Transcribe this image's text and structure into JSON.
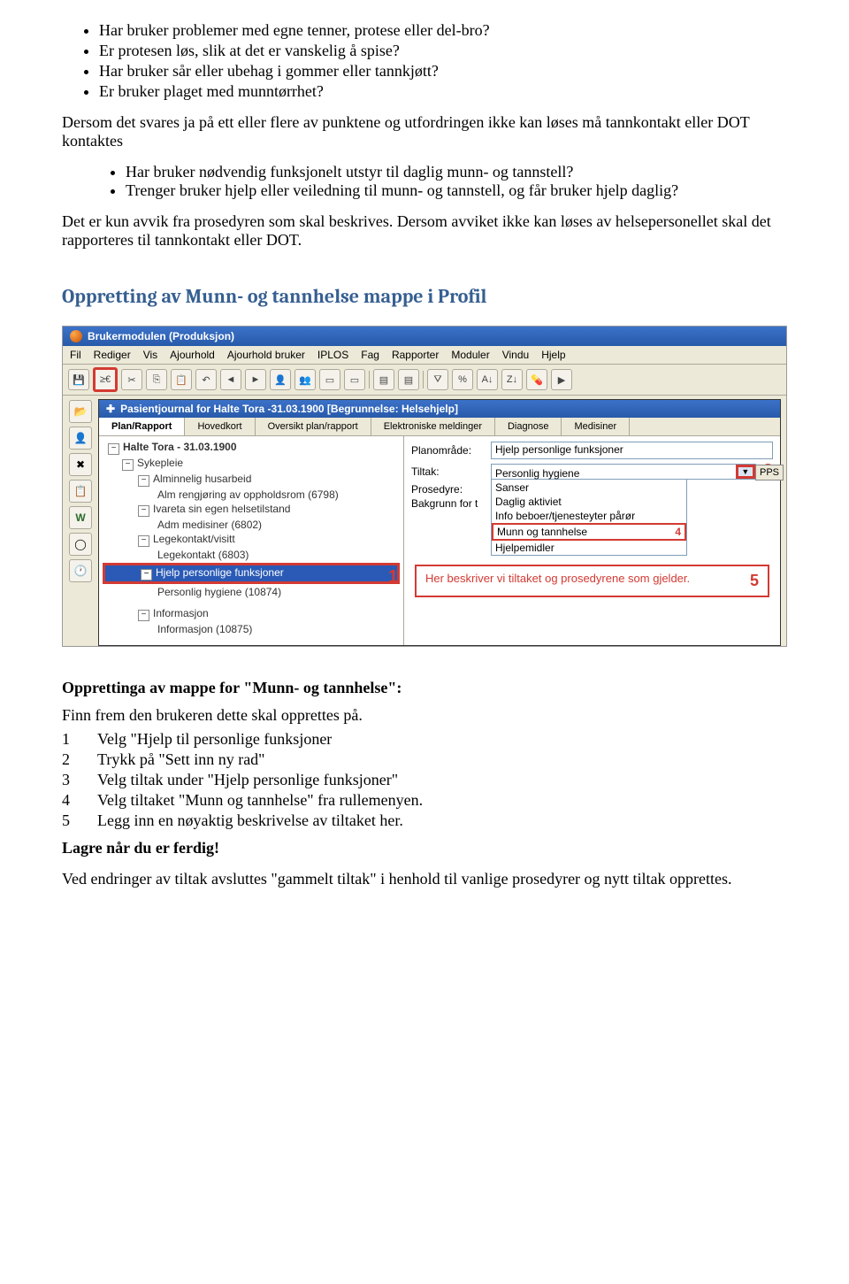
{
  "bullets1": [
    "Har bruker problemer med egne tenner, protese eller del-bro?",
    "Er protesen løs, slik at det er vanskelig å spise?",
    "Har bruker sår eller ubehag i gommer eller tannkjøtt?",
    "Er bruker plaget med munntørrhet?"
  ],
  "para1": "Dersom det svares ja på ett eller flere av punktene og utfordringen ikke kan løses må tannkontakt eller DOT kontaktes",
  "bullets2": [
    "Har bruker nødvendig funksjonelt utstyr til daglig munn- og tannstell?",
    "Trenger bruker hjelp eller veiledning til munn- og tannstell, og får bruker hjelp daglig?"
  ],
  "para2": "Det er kun avvik fra prosedyren som skal beskrives. Dersom avviket ikke kan løses av helsepersonellet skal det rapporteres til tannkontakt eller DOT.",
  "section_title": "Oppretting av Munn- og tannhelse mappe i Profil",
  "app": {
    "title": "Brukermodulen (Produksjon)",
    "menus": [
      "Fil",
      "Rediger",
      "Vis",
      "Ajourhold",
      "Ajourhold bruker",
      "IPLOS",
      "Fag",
      "Rapporter",
      "Moduler",
      "Vindu",
      "Hjelp"
    ],
    "toolbar_icons": [
      "save",
      "insert-row",
      "cut",
      "copy",
      "paste",
      "undo",
      "arrow-left",
      "arrow-right",
      "user",
      "users",
      "page",
      "page2",
      "sep",
      "doc",
      "doc2",
      "sep",
      "filter",
      "percent",
      "sort-asc",
      "sort-desc",
      "pill",
      "play"
    ],
    "journal_title": "Pasientjournal for   Halte Tora  -31.03.1900        [Begrunnelse: Helsehjelp]",
    "tabs": [
      "Plan/Rapport",
      "Hovedkort",
      "Oversikt plan/rapport",
      "Elektroniske meldinger",
      "Diagnose",
      "Medisiner"
    ],
    "tree": {
      "root": "Halte Tora - 31.03.1900",
      "items": [
        {
          "lvl": 1,
          "exp": "-",
          "txt": "Sykepleie"
        },
        {
          "lvl": 2,
          "exp": "-",
          "txt": "Alminnelig husarbeid"
        },
        {
          "lvl": 3,
          "txt": "Alm rengjøring av oppholdsrom (6798)"
        },
        {
          "lvl": 2,
          "exp": "-",
          "txt": "Ivareta sin egen helsetilstand"
        },
        {
          "lvl": 3,
          "txt": "Adm medisiner (6802)"
        },
        {
          "lvl": 2,
          "exp": "-",
          "txt": "Legekontakt/visitt"
        },
        {
          "lvl": 3,
          "txt": "Legekontakt (6803)"
        },
        {
          "lvl": 2,
          "exp": "-",
          "txt": "Hjelp personlige funksjoner",
          "selected": true,
          "mark": true
        },
        {
          "lvl": 3,
          "txt": "Personlig hygiene (10874)"
        },
        {
          "lvl": 2,
          "exp": "-",
          "txt": "Informasjon"
        },
        {
          "lvl": 3,
          "txt": "Informasjon (10875)"
        }
      ]
    },
    "fields": {
      "planomrade_lbl": "Planområde:",
      "planomrade": "Hjelp personlige funksjoner",
      "tiltak_lbl": "Tiltak:",
      "prosedyre_lbl": "Prosedyre:",
      "bakgrunn_lbl": "Bakgrunn for t"
    },
    "options": [
      "Personlig hygiene",
      "Sanser",
      "Daglig aktiviet",
      "Info beboer/tjenesteyter pårør",
      "Munn og tannhelse",
      "Hjelpemidler"
    ],
    "pps": "PPS",
    "annot_text": "Her beskriver vi tiltaket og prosedyrene som gjelder.",
    "marks": {
      "n1": "1",
      "n3": "3",
      "n4": "4",
      "n5": "5"
    }
  },
  "bottom": {
    "h": "Opprettinga av mappe for \"Munn- og tannhelse\":",
    "intro": "Finn frem den brukeren dette skal opprettes på.",
    "steps": [
      [
        "1",
        "Velg \"Hjelp til personlige funksjoner"
      ],
      [
        "2",
        "Trykk på \"Sett inn ny rad\""
      ],
      [
        "3",
        "Velg tiltak under \"Hjelp personlige funksjoner\""
      ],
      [
        "4",
        "Velg tiltaket \"Munn og tannhelse\" fra rullemenyen."
      ],
      [
        "5",
        "Legg inn en nøyaktig beskrivelse av tiltaket her."
      ]
    ],
    "save": "Lagre når du er ferdig!",
    "end": "Ved endringer av tiltak avsluttes \"gammelt tiltak\" i henhold til vanlige prosedyrer og nytt tiltak opprettes."
  }
}
